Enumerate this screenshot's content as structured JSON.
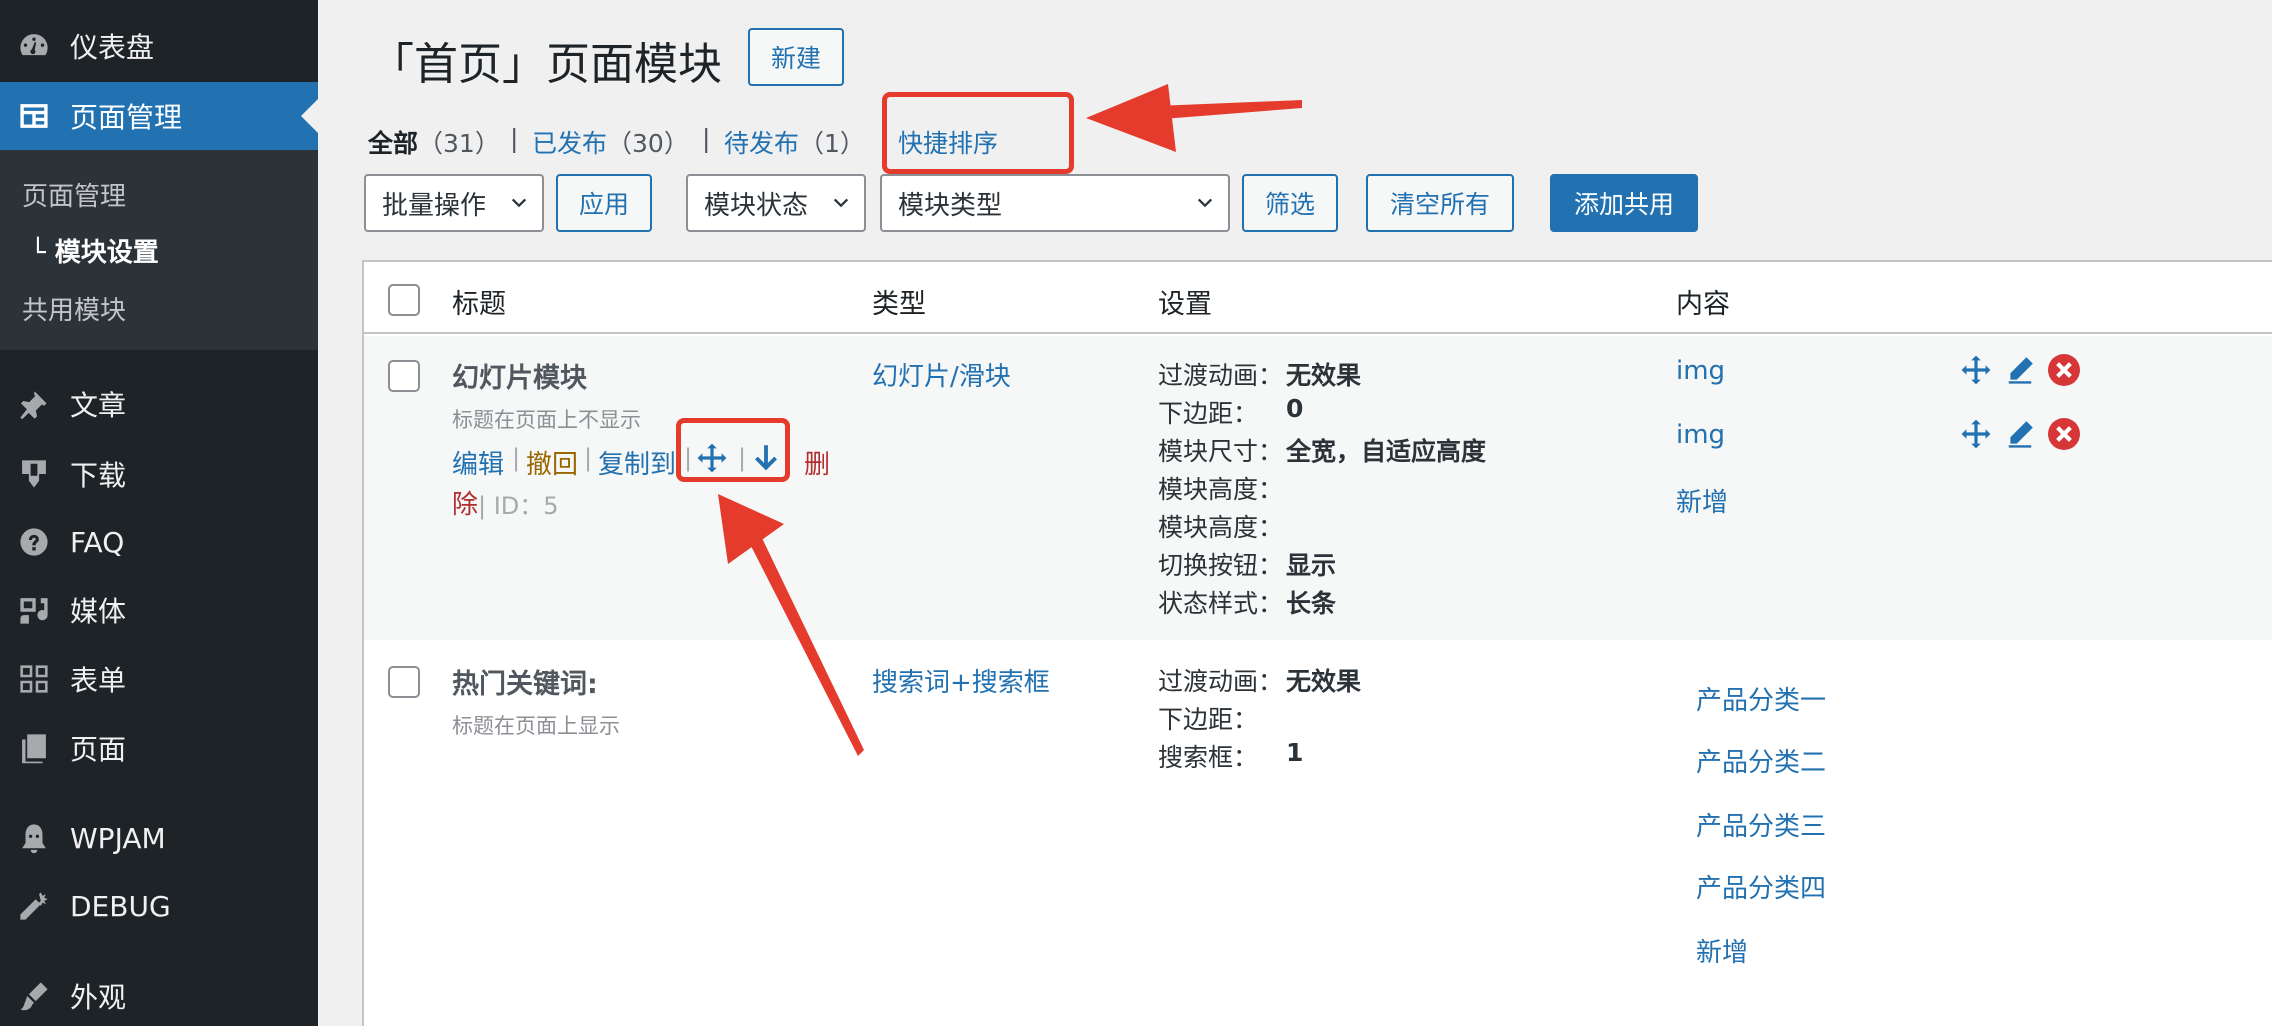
{
  "sidebar": {
    "items": [
      {
        "label": "仪表盘",
        "icon": "dashboard-icon"
      },
      {
        "label": "页面管理",
        "icon": "page-manage-icon"
      },
      {
        "label": "文章",
        "icon": "pin-icon"
      },
      {
        "label": "下载",
        "icon": "download-icon"
      },
      {
        "label": "FAQ",
        "icon": "question-icon"
      },
      {
        "label": "媒体",
        "icon": "media-icon"
      },
      {
        "label": "表单",
        "icon": "form-icon"
      },
      {
        "label": "页面",
        "icon": "pages-icon"
      },
      {
        "label": "WPJAM",
        "icon": "wpjam-icon"
      },
      {
        "label": "DEBUG",
        "icon": "carrot-icon"
      },
      {
        "label": "外观",
        "icon": "brush-icon"
      }
    ],
    "submenu": [
      {
        "label": "页面管理"
      },
      {
        "label": "└ 模块设置"
      },
      {
        "label": "共用模块"
      }
    ]
  },
  "header": {
    "title": "「首页」页面模块",
    "new_button": "新建"
  },
  "filters": {
    "all_label": "全部",
    "all_count": "（31）",
    "published_label": "已发布",
    "published_count": "（30）",
    "pending_label": "待发布",
    "pending_count": "（1）",
    "quick_sort": "快捷排序",
    "separator": "|"
  },
  "tablenav": {
    "bulk_action": "批量操作",
    "apply": "应用",
    "module_status": "模块状态",
    "module_type": "模块类型",
    "filter": "筛选",
    "clear_all": "清空所有",
    "add_shared": "添加共用"
  },
  "table": {
    "headers": {
      "title": "标题",
      "type": "类型",
      "settings": "设置",
      "content": "内容"
    },
    "rows": [
      {
        "title": "幻灯片模块",
        "note": "标题在页面上不显示",
        "actions": {
          "edit": "编辑",
          "undo": "撤回",
          "copy": "复制到",
          "delete_1": "删",
          "delete_2": "除",
          "id": "| ID：5"
        },
        "type": "幻灯片/滑块",
        "settings": [
          {
            "k": "过渡动画：",
            "v": "无效果"
          },
          {
            "k": "下边距：",
            "v": "0"
          },
          {
            "k": "模块尺寸：",
            "v": "全宽，自适应高度"
          },
          {
            "k": "模块高度：",
            "v": ""
          },
          {
            "k": "模块高度：",
            "v": ""
          },
          {
            "k": "切换按钮：",
            "v": "显示"
          },
          {
            "k": "状态样式：",
            "v": "长条"
          }
        ],
        "content": [
          "img",
          "img"
        ],
        "content_add": "新增"
      },
      {
        "title": "热门关键词:",
        "note": "标题在页面上显示",
        "type": "搜索词+搜索框",
        "settings": [
          {
            "k": "过渡动画：",
            "v": "无效果"
          },
          {
            "k": "下边距：",
            "v": ""
          },
          {
            "k": "搜索框：",
            "v": "1"
          }
        ],
        "content": [
          "产品分类一",
          "产品分类二",
          "产品分类三",
          "产品分类四"
        ],
        "content_add": "新增"
      }
    ]
  },
  "colors": {
    "sidebar_bg": "#1d2327",
    "accent": "#2271b1",
    "annotation": "#e53b2c",
    "delete": "#d63638"
  }
}
